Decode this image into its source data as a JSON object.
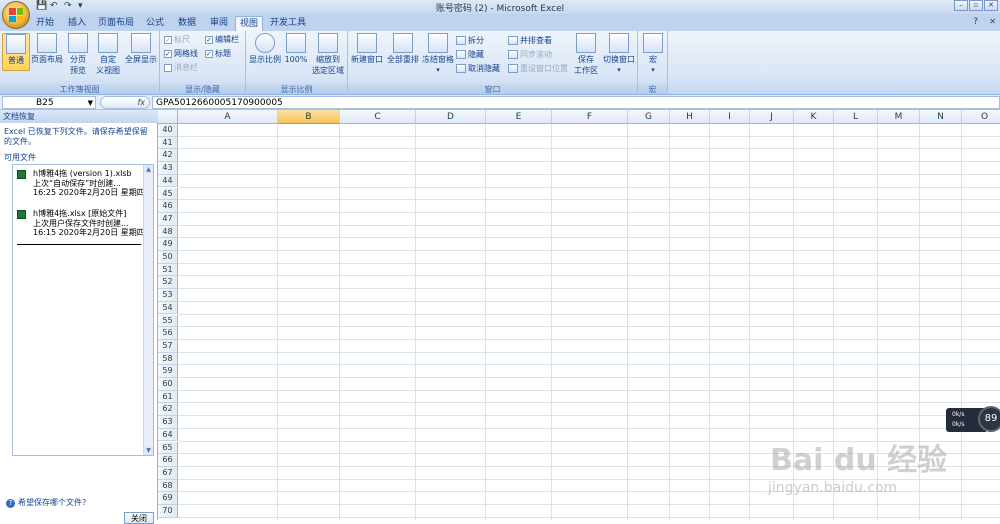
{
  "window": {
    "title": "账号密码 (2) - Microsoft Excel",
    "buttons": [
      "–",
      "▫",
      "✕"
    ]
  },
  "quick_access": {
    "undo": "↶",
    "redo": "↷"
  },
  "tabs": [
    {
      "label": "开始",
      "active": false
    },
    {
      "label": "插入",
      "active": false
    },
    {
      "label": "页面布局",
      "active": false
    },
    {
      "label": "公式",
      "active": false
    },
    {
      "label": "数据",
      "active": false
    },
    {
      "label": "审阅",
      "active": false
    },
    {
      "label": "视图",
      "active": true
    },
    {
      "label": "开发工具",
      "active": false
    }
  ],
  "ribbon": {
    "workbook_views": {
      "label": "工作簿视图",
      "normal": "普通",
      "page_layout": "页面布局",
      "page_break_1": "分页",
      "page_break_2": "预览",
      "custom_1": "自定",
      "custom_2": "义视图",
      "fullscreen": "全屏显示"
    },
    "show_hide": {
      "label": "显示/隐藏",
      "ruler": "标尺",
      "gridlines": "网格线",
      "message_bar": "消息栏",
      "formula_bar": "编辑栏",
      "headings": "标题"
    },
    "zoom": {
      "label": "显示比例",
      "zoom": "显示比例",
      "hundred": "100%",
      "selection_1": "缩放到",
      "selection_2": "选定区域"
    },
    "window": {
      "label": "窗口",
      "new_window": "新建窗口",
      "arrange_all": "全部重排",
      "freeze_panes": "冻结窗格",
      "split": "拆分",
      "hide": "隐藏",
      "unhide": "取消隐藏",
      "side_by_side": "并排查看",
      "sync_scroll": "同步滚动",
      "reset_position": "重设窗口位置",
      "save_workspace_1": "保存",
      "save_workspace_2": "工作区",
      "switch_windows": "切换窗口"
    },
    "macros": {
      "label": "宏",
      "macros": "宏"
    }
  },
  "formula_bar": {
    "name_box": "B25",
    "fx": "fx",
    "value": "GPA5012660005170900005"
  },
  "recovery_pane": {
    "title": "文档恢复",
    "message": "Excel 已恢复下列文件。请保存希望保留的文件。",
    "available": "可用文件",
    "files": [
      {
        "name": "h博雅4拖 (version 1).xlsb",
        "status": "上次“自动保存”时创建...",
        "time": "16:25 2020年2月20日 星期四"
      },
      {
        "name": "h博雅4拖.xlsx  [原始文件]",
        "status": "上次用户保存文件时创建...",
        "time": "16:15 2020年2月20日 星期四"
      }
    ],
    "help": "希望保存哪个文件?",
    "close": "关闭"
  },
  "grid": {
    "columns": [
      "A",
      "B",
      "C",
      "D",
      "E",
      "F",
      "G",
      "H",
      "I",
      "J",
      "K",
      "L",
      "M",
      "N",
      "O"
    ],
    "selected_column": "B",
    "rows": [
      40,
      41,
      42,
      43,
      44,
      45,
      46,
      47,
      48,
      49,
      50,
      51,
      52,
      53,
      54,
      55,
      56,
      57,
      58,
      59,
      60,
      61,
      62,
      63,
      64,
      65,
      66,
      67,
      68,
      69,
      70
    ]
  },
  "widget": {
    "up": "0k/s",
    "down": "0k/s",
    "value": "89"
  },
  "watermark": {
    "main": "Bai du 经验",
    "sub": "jingyan.baidu.com"
  }
}
